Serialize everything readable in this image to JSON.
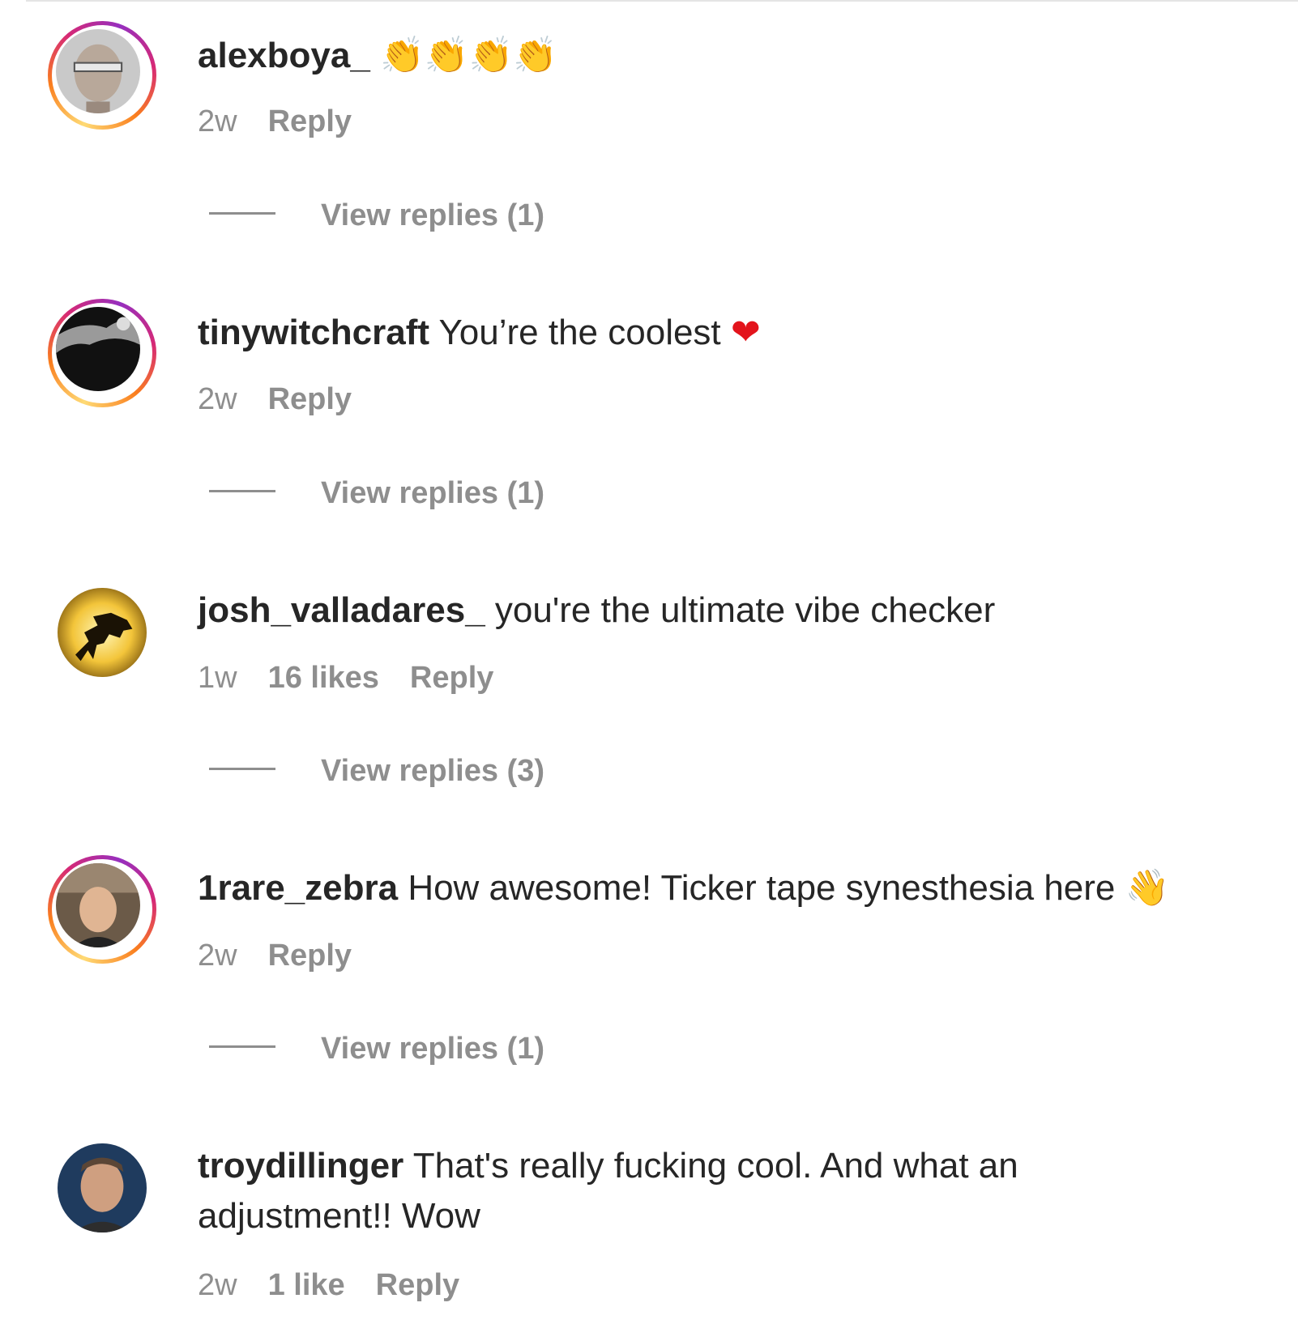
{
  "comments": [
    {
      "username": "alexboya_",
      "text": "",
      "emoji": "👏👏👏👏",
      "time": "2w",
      "likes": "",
      "reply_label": "Reply",
      "view_replies": "View replies (1)"
    },
    {
      "username": "tinywitchcraft",
      "text": "You’re the coolest",
      "emoji": "❤",
      "time": "2w",
      "likes": "",
      "reply_label": "Reply",
      "view_replies": "View replies (1)"
    },
    {
      "username": "josh_valladares_",
      "text": "you're the ultimate vibe checker",
      "emoji": "",
      "time": "1w",
      "likes": "16 likes",
      "reply_label": "Reply",
      "view_replies": "View replies (3)"
    },
    {
      "username": "1rare_zebra",
      "text": "How awesome! Ticker tape synesthesia here",
      "emoji": "👋",
      "time": "2w",
      "likes": "",
      "reply_label": "Reply",
      "view_replies": "View replies (1)"
    },
    {
      "username": "troydillinger",
      "text": "That's really fucking cool. And what an adjustment!! Wow",
      "emoji": "",
      "time": "2w",
      "likes": "1 like",
      "reply_label": "Reply",
      "view_replies": ""
    }
  ],
  "colors": {
    "text": "#262626",
    "secondary": "#8e8e8e",
    "heart": "#e3141c",
    "story_ring": "#d62976"
  }
}
